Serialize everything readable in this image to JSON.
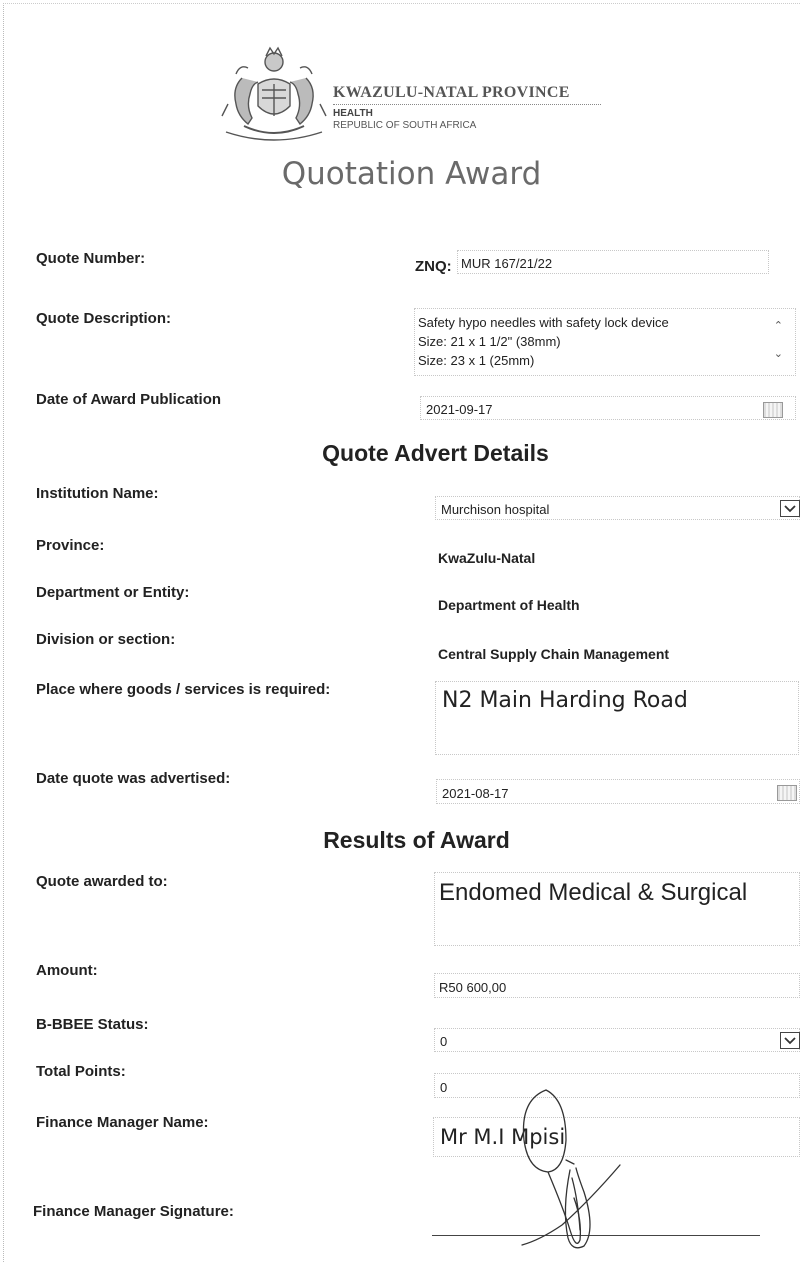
{
  "header": {
    "org_name": "KWAZULU-NATAL PROVINCE",
    "dept": "HEALTH",
    "country": "REPUBLIC OF SOUTH AFRICA",
    "title": "Quotation Award"
  },
  "quote": {
    "number_label": "Quote Number:",
    "number_prefix": "ZNQ:",
    "number_value": "MUR 167/21/22",
    "desc_label": "Quote Description:",
    "desc_line1": "Safety hypo needles with safety lock device",
    "desc_line2": "Size: 21 x 1 1/2\" (38mm)",
    "desc_line3": "Size: 23 x 1 (25mm)",
    "date_label": "Date of Award Publication",
    "date_value": "2021-09-17"
  },
  "advert": {
    "heading": "Quote Advert Details",
    "institution_label": "Institution Name:",
    "institution_value": "Murchison hospital",
    "province_label": "Province:",
    "province_value": "KwaZulu-Natal",
    "dept_label": "Department or Entity:",
    "dept_value": "Department of Health",
    "division_label": "Division or section:",
    "division_value": "Central Supply Chain Management",
    "place_label": "Place where goods /  services is required:",
    "place_value": "N2 Main Harding Road",
    "advertised_label": "Date quote was advertised:",
    "advertised_value": "2021-08-17"
  },
  "results": {
    "heading": "Results of Award",
    "awarded_label": "Quote awarded to:",
    "awarded_value": "Endomed Medical & Surgical",
    "amount_label": "Amount:",
    "amount_value": "R50 600,00",
    "bbbee_label": "B-BBEE Status:",
    "bbbee_value": "0",
    "points_label": "Total Points:",
    "points_value": "0",
    "fm_name_label": "Finance Manager Name:",
    "fm_name_value": "Mr M.I Mpisi",
    "fm_sig_label": "Finance Manager Signature:"
  }
}
